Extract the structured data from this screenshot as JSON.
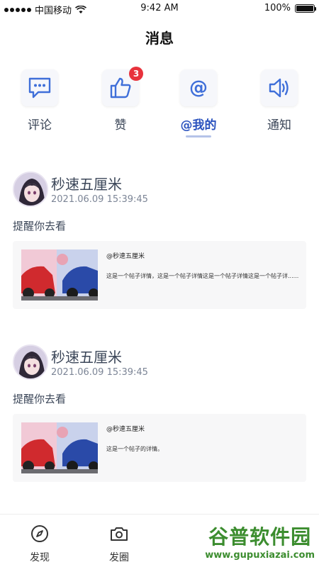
{
  "status_bar": {
    "carrier": "中国移动",
    "time": "9:42 AM",
    "battery": "100%"
  },
  "page": {
    "title": "消息"
  },
  "tabs": [
    {
      "label": "评论",
      "icon": "comment-icon"
    },
    {
      "label": "赞",
      "icon": "thumbs-up-icon",
      "badge": "3"
    },
    {
      "label": "@我的",
      "icon": "at-icon",
      "active": true
    },
    {
      "label": "通知",
      "icon": "speaker-icon"
    }
  ],
  "posts": [
    {
      "user": "秒速五厘米",
      "time": "2021.06.09   15:39:45",
      "message": "提醒你去看",
      "card": {
        "title": "@秒速五厘米",
        "desc": "这是一个帖子详情，这是一个帖子详情这是一个帖子详情这是一个帖子详......"
      }
    },
    {
      "user": "秒速五厘米",
      "time": "2021.06.09   15:39:45",
      "message": "提醒你去看",
      "card": {
        "title": "@秒速五厘米",
        "desc": "这是一个帖子的详情。"
      }
    }
  ],
  "bottom_nav": [
    {
      "label": "发现",
      "icon": "compass-icon"
    },
    {
      "label": "发圈",
      "icon": "camera-icon"
    }
  ],
  "watermark": {
    "title": "谷普软件园",
    "url": "www.gupuxiazai.com"
  }
}
